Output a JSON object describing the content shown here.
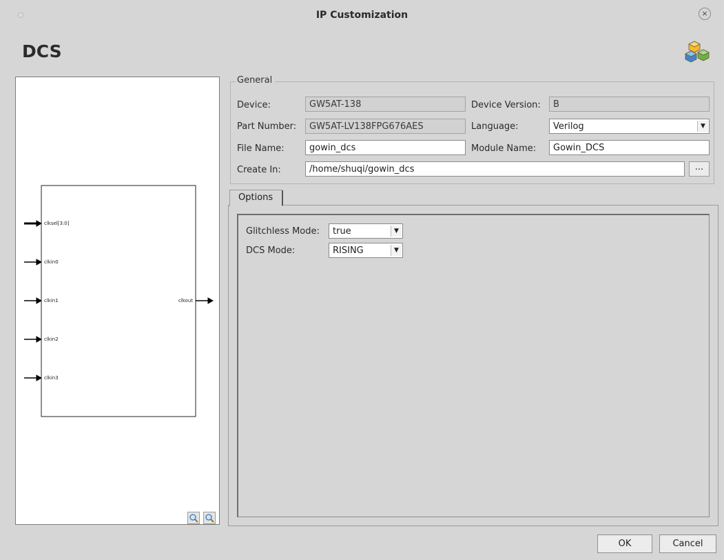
{
  "window": {
    "title": "IP Customization",
    "close_glyph": "×"
  },
  "header": {
    "title": "DCS",
    "logo_icon": "ip-cubes-icon"
  },
  "preview": {
    "inputs": [
      "clksel[3:0]",
      "clkin0",
      "clkin1",
      "clkin2",
      "clkin3"
    ],
    "output": "clkout"
  },
  "general": {
    "legend": "General",
    "device_label": "Device:",
    "device_value": "GW5AT-138",
    "device_version_label": "Device Version:",
    "device_version_value": "B",
    "part_number_label": "Part Number:",
    "part_number_value": "GW5AT-LV138FPG676AES",
    "language_label": "Language:",
    "language_value": "Verilog",
    "file_name_label": "File Name:",
    "file_name_value": "gowin_dcs",
    "module_name_label": "Module Name:",
    "module_name_value": "Gowin_DCS",
    "create_in_label": "Create In:",
    "create_in_value": "/home/shuqi/gowin_dcs",
    "browse_label": "..."
  },
  "options": {
    "tab_label": "Options",
    "glitchless_label": "Glitchless Mode:",
    "glitchless_value": "true",
    "dcs_mode_label": "DCS Mode:",
    "dcs_mode_value": "RISING"
  },
  "footer": {
    "ok_label": "OK",
    "cancel_label": "Cancel"
  },
  "colors": {
    "background": "#d6d6d6",
    "readonly_field": "#d2d2d2",
    "preview_bg": "#ffffff"
  }
}
